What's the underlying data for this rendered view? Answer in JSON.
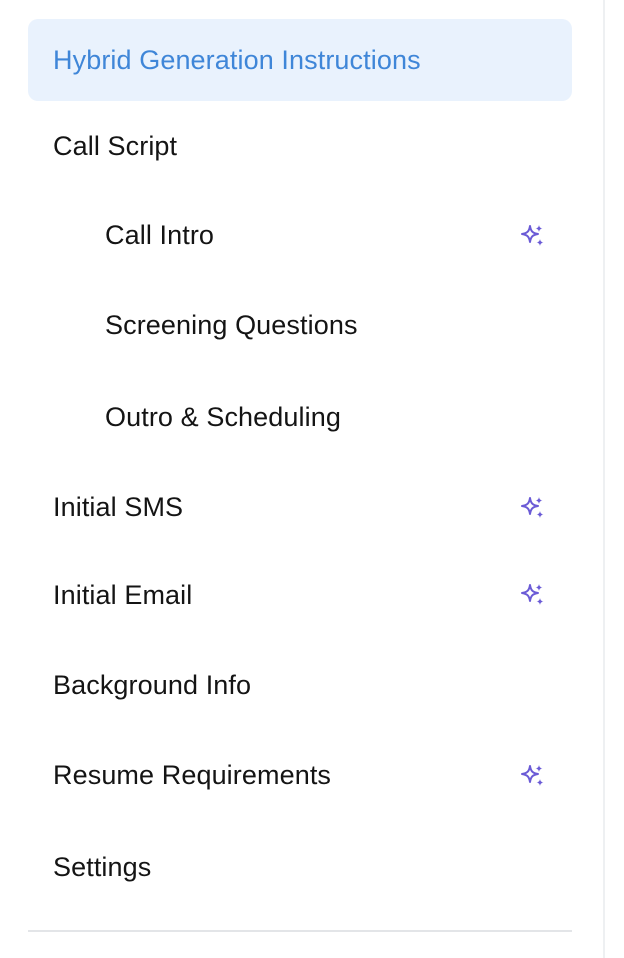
{
  "nav": {
    "items": [
      {
        "label": "Hybrid Generation Instructions",
        "level": 1,
        "active": true,
        "sparkle": false
      },
      {
        "label": "Call Script",
        "level": 1,
        "active": false,
        "sparkle": false
      },
      {
        "label": "Call Intro",
        "level": 2,
        "active": false,
        "sparkle": true
      },
      {
        "label": "Screening Questions",
        "level": 2,
        "active": false,
        "sparkle": false
      },
      {
        "label": "Outro & Scheduling",
        "level": 2,
        "active": false,
        "sparkle": false
      },
      {
        "label": "Initial SMS",
        "level": 1,
        "active": false,
        "sparkle": true
      },
      {
        "label": "Initial Email",
        "level": 1,
        "active": false,
        "sparkle": true
      },
      {
        "label": "Background Info",
        "level": 1,
        "active": false,
        "sparkle": false
      },
      {
        "label": "Resume Requirements",
        "level": 1,
        "active": false,
        "sparkle": true
      },
      {
        "label": "Settings",
        "level": 1,
        "active": false,
        "sparkle": false
      }
    ]
  },
  "colors": {
    "active_bg": "#e9f2fd",
    "active_text": "#3f86d8",
    "text": "#141414",
    "sparkle": "#6b5bd6"
  },
  "icons": {
    "sparkle": "sparkle-icon"
  }
}
